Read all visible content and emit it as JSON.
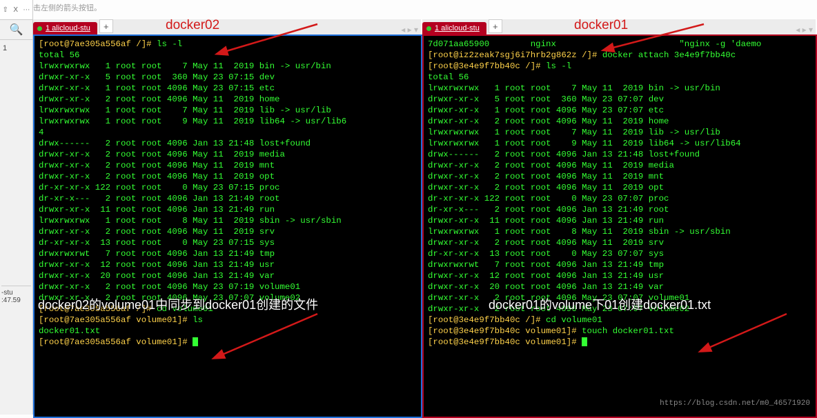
{
  "hint": "击左侧的箭头按钮。",
  "gutter": {
    "pin": "⇧",
    "x": "X",
    "dots": "⋯",
    "num": "1",
    "stu": "-stu",
    "time": ":47.59"
  },
  "tab": {
    "title": "1 alicloud-stu",
    "plus": "+",
    "nav": "◂  ▸  ▾"
  },
  "labels": {
    "docker02": "docker02",
    "docker01": "docker01",
    "overlay_left": "docker02的volume01中同步到docker01创建的文件",
    "overlay_right": "docker01的volume下01创建docker01.txt"
  },
  "watermark": "https://blog.csdn.net/m0_46571920",
  "term_left": [
    {
      "y": "[root@7ae305a556af /]# ",
      "g": "ls -l"
    },
    {
      "g": "total 56"
    },
    {
      "g": "lrwxrwxrwx   1 root root    7 May 11  2019 bin -> usr/bin"
    },
    {
      "g": "drwxr-xr-x   5 root root  360 May 23 07:15 dev"
    },
    {
      "g": "drwxr-xr-x   1 root root 4096 May 23 07:15 etc"
    },
    {
      "g": "drwxr-xr-x   2 root root 4096 May 11  2019 home"
    },
    {
      "g": "lrwxrwxrwx   1 root root    7 May 11  2019 lib -> usr/lib"
    },
    {
      "g": "lrwxrwxrwx   1 root root    9 May 11  2019 lib64 -> usr/lib6"
    },
    {
      "g": "4"
    },
    {
      "g": "drwx------   2 root root 4096 Jan 13 21:48 lost+found"
    },
    {
      "g": "drwxr-xr-x   2 root root 4096 May 11  2019 media"
    },
    {
      "g": "drwxr-xr-x   2 root root 4096 May 11  2019 mnt"
    },
    {
      "g": "drwxr-xr-x   2 root root 4096 May 11  2019 opt"
    },
    {
      "g": "dr-xr-xr-x 122 root root    0 May 23 07:15 proc"
    },
    {
      "g": "dr-xr-x---   2 root root 4096 Jan 13 21:49 root"
    },
    {
      "g": "drwxr-xr-x  11 root root 4096 Jan 13 21:49 run"
    },
    {
      "g": "lrwxrwxrwx   1 root root    8 May 11  2019 sbin -> usr/sbin"
    },
    {
      "g": "drwxr-xr-x   2 root root 4096 May 11  2019 srv"
    },
    {
      "g": "dr-xr-xr-x  13 root root    0 May 23 07:15 sys"
    },
    {
      "g": "drwxrwxrwt   7 root root 4096 Jan 13 21:49 tmp"
    },
    {
      "g": "drwxr-xr-x  12 root root 4096 Jan 13 21:49 usr"
    },
    {
      "g": "drwxr-xr-x  20 root root 4096 Jan 13 21:49 var"
    },
    {
      "g": "drwxr-xr-x   2 root root 4096 May 23 07:19 volume01"
    },
    {
      "g": "drwxr-xr-x   2 root root 4096 May 23 07:07 volume02"
    },
    {
      "y": "[root@7ae305a556af /]# ",
      "g": "cd volume01"
    },
    {
      "y": "[root@7ae305a556af volume01]# ",
      "g": "ls"
    },
    {
      "g": "docker01.txt"
    },
    {
      "y": "[root@7ae305a556af volume01]# ",
      "cursor": true
    }
  ],
  "term_right": [
    {
      "g": "7d071aa65900        nginx                        \"nginx -g 'daemo"
    },
    {
      "y": "[root@iz2zeak7sgj6i7hrb2g862z /]# ",
      "g": "docker attach 3e4e9f7bb40c"
    },
    {
      "y": "[root@3e4e9f7bb40c /]# ",
      "g": "ls -l"
    },
    {
      "g": "total 56"
    },
    {
      "g": "lrwxrwxrwx   1 root root    7 May 11  2019 bin -> usr/bin"
    },
    {
      "g": "drwxr-xr-x   5 root root  360 May 23 07:07 dev"
    },
    {
      "g": "drwxr-xr-x   1 root root 4096 May 23 07:07 etc"
    },
    {
      "g": "drwxr-xr-x   2 root root 4096 May 11  2019 home"
    },
    {
      "g": "lrwxrwxrwx   1 root root    7 May 11  2019 lib -> usr/lib"
    },
    {
      "g": "lrwxrwxrwx   1 root root    9 May 11  2019 lib64 -> usr/lib64"
    },
    {
      "g": "drwx------   2 root root 4096 Jan 13 21:48 lost+found"
    },
    {
      "g": "drwxr-xr-x   2 root root 4096 May 11  2019 media"
    },
    {
      "g": "drwxr-xr-x   2 root root 4096 May 11  2019 mnt"
    },
    {
      "g": "drwxr-xr-x   2 root root 4096 May 11  2019 opt"
    },
    {
      "g": "dr-xr-xr-x 122 root root    0 May 23 07:07 proc"
    },
    {
      "g": "dr-xr-x---   2 root root 4096 Jan 13 21:49 root"
    },
    {
      "g": "drwxr-xr-x  11 root root 4096 Jan 13 21:49 run"
    },
    {
      "g": "lrwxrwxrwx   1 root root    8 May 11  2019 sbin -> usr/sbin"
    },
    {
      "g": "drwxr-xr-x   2 root root 4096 May 11  2019 srv"
    },
    {
      "g": "dr-xr-xr-x  13 root root    0 May 23 07:07 sys"
    },
    {
      "g": "drwxrwxrwt   7 root root 4096 Jan 13 21:49 tmp"
    },
    {
      "g": "drwxr-xr-x  12 root root 4096 Jan 13 21:49 usr"
    },
    {
      "g": "drwxr-xr-x  20 root root 4096 Jan 13 21:49 var"
    },
    {
      "g": "drwxr-xr-x   2 root root 4096 May 23 07:07 volume01"
    },
    {
      "g": "drwxr-xr-x   2 root root 4096 May 23 07:07 volume02"
    },
    {
      "y": "[root@3e4e9f7bb40c /]# ",
      "g": "cd volume01"
    },
    {
      "y": "[root@3e4e9f7bb40c volume01]# ",
      "g": "touch docker01.txt"
    },
    {
      "y": "[root@3e4e9f7bb40c volume01]# ",
      "cursor": true
    }
  ]
}
